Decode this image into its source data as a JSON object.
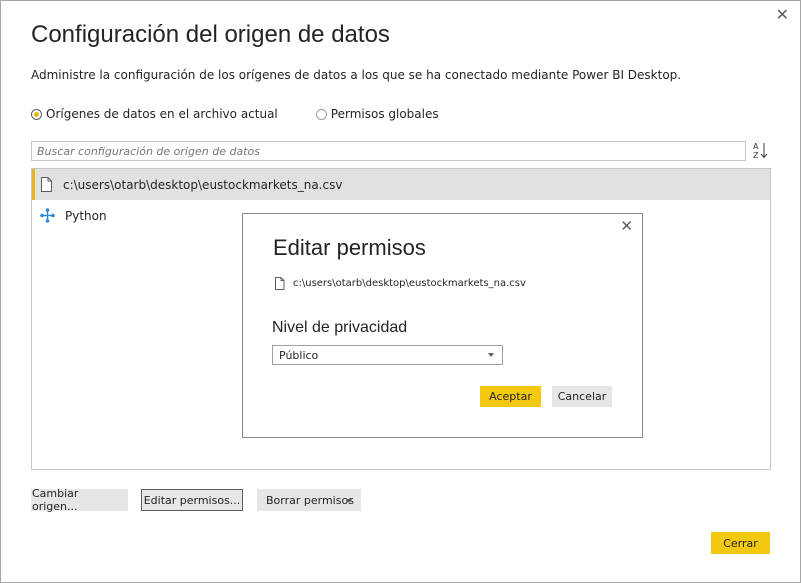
{
  "dialog": {
    "title": "Configuración del origen de datos",
    "description": "Administre la configuración de los orígenes de datos a los que se ha conectado mediante Power BI Desktop.",
    "close_glyph": "✕",
    "scope": {
      "options": [
        {
          "label": "Orígenes de datos en el archivo actual",
          "checked": true
        },
        {
          "label": "Permisos globales",
          "checked": false
        }
      ]
    },
    "search": {
      "placeholder": "Buscar configuración de origen de datos",
      "value": ""
    },
    "sort_icon": "sort-az-icon",
    "sources": [
      {
        "label": "c:\\users\\otarb\\desktop\\eustockmarkets_na.csv",
        "icon": "file-icon",
        "selected": true
      },
      {
        "label": "Python",
        "icon": "python-connector-icon",
        "selected": false
      }
    ],
    "buttons": {
      "change_source": "Cambiar origen...",
      "edit_permissions": "Editar permisos...",
      "clear_permissions": "Borrar permisos",
      "close": "Cerrar"
    }
  },
  "modal": {
    "title": "Editar permisos",
    "close_glyph": "✕",
    "file_path": "c:\\users\\otarb\\desktop\\eustockmarkets_na.csv",
    "privacy_label": "Nivel de privacidad",
    "privacy_value": "Público",
    "accept": "Aceptar",
    "cancel": "Cancelar"
  },
  "colors": {
    "accent": "#f2c811",
    "radio_accent": "#e8b520",
    "selected_row": "#e1e1e1"
  }
}
